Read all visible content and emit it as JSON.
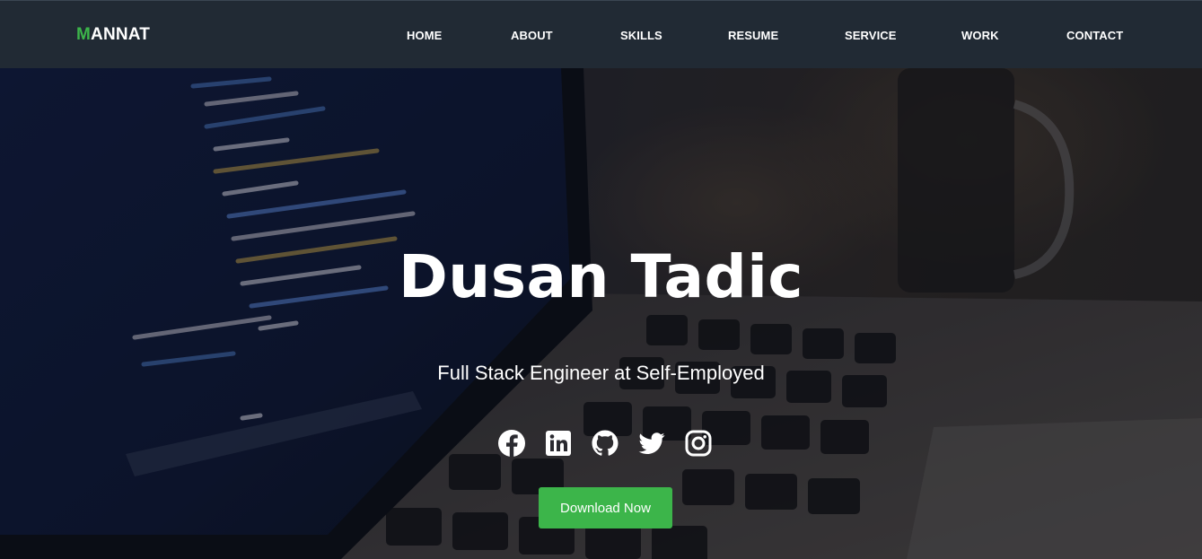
{
  "navbar": {
    "brand_first": "M",
    "brand_rest": "ANNAT",
    "items": [
      {
        "label": "HOME"
      },
      {
        "label": "ABOUT"
      },
      {
        "label": "SKILLS"
      },
      {
        "label": "RESUME"
      },
      {
        "label": "SERVICE"
      },
      {
        "label": "WORK"
      },
      {
        "label": "CONTACT"
      }
    ]
  },
  "hero": {
    "name": "Dusan Tadic",
    "subtitle": "Full Stack Engineer at Self-Employed",
    "download_label": "Download Now",
    "socials": [
      {
        "icon": "facebook-icon"
      },
      {
        "icon": "linkedin-icon"
      },
      {
        "icon": "github-icon"
      },
      {
        "icon": "twitter-icon"
      },
      {
        "icon": "instagram-icon"
      }
    ]
  },
  "colors": {
    "accent": "#3cb54a",
    "navbar_bg": "#212a34",
    "text": "#ffffff"
  }
}
